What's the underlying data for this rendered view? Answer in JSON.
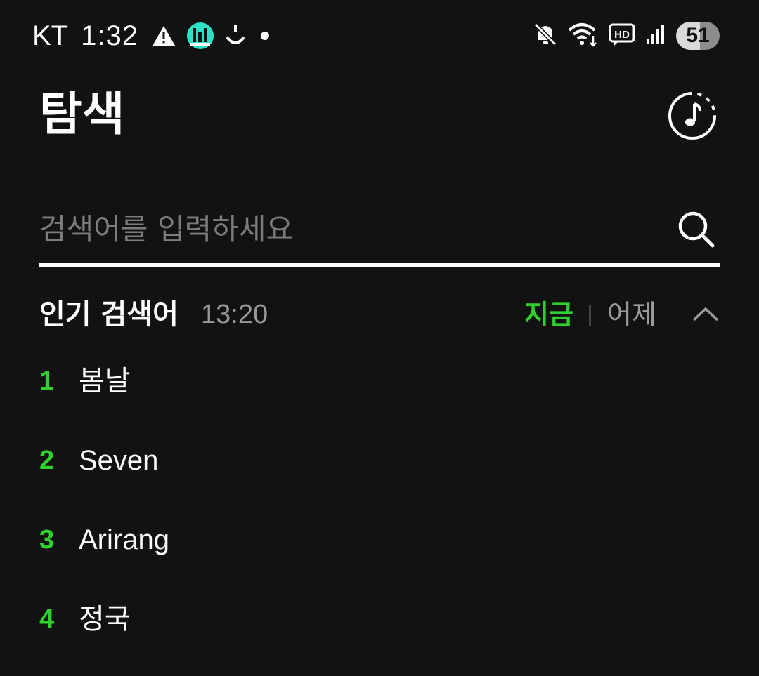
{
  "status_bar": {
    "carrier": "KT",
    "time": "1:32",
    "battery": "51",
    "icons": [
      "warning-icon",
      "app-notification-icon",
      "smile-icon",
      "dot-icon",
      "mute-icon",
      "wifi-icon",
      "hd-voice-icon",
      "signal-icon",
      "battery-icon"
    ]
  },
  "header": {
    "title": "탐색",
    "music_icon": "music-note-icon"
  },
  "search": {
    "placeholder": "검색어를 입력하세요",
    "value": "",
    "icon": "search-icon"
  },
  "popular": {
    "title": "인기 검색어",
    "time": "13:20",
    "tabs": [
      {
        "label": "지금",
        "active": true
      },
      {
        "label": "어제",
        "active": false
      }
    ],
    "collapse_icon": "chevron-up-icon",
    "items": [
      {
        "rank": "1",
        "term": "봄날"
      },
      {
        "rank": "2",
        "term": "Seven"
      },
      {
        "rank": "3",
        "term": "Arirang"
      },
      {
        "rank": "4",
        "term": "정국"
      }
    ]
  },
  "colors": {
    "background": "#121212",
    "accent": "#2ed12e",
    "muted": "#9a9a9a"
  }
}
